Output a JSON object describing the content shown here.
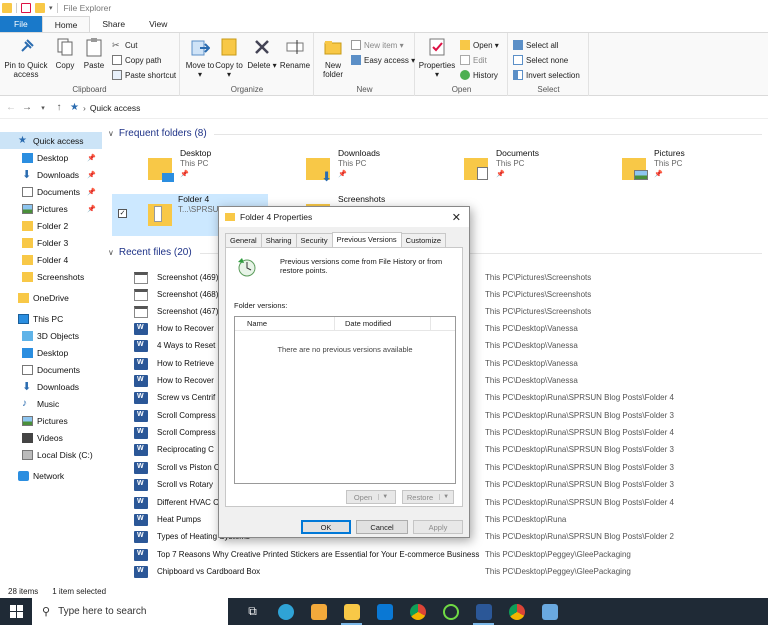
{
  "window": {
    "title": "File Explorer"
  },
  "ribbon": {
    "tabs": [
      "File",
      "Home",
      "Share",
      "View"
    ],
    "clipboard": {
      "label": "Clipboard",
      "pin": "Pin to Quick access",
      "copy": "Copy",
      "paste": "Paste",
      "cut": "Cut",
      "copy_path": "Copy path",
      "paste_shortcut": "Paste shortcut"
    },
    "organize": {
      "label": "Organize",
      "move_to": "Move to",
      "copy_to": "Copy to",
      "delete": "Delete",
      "rename": "Rename"
    },
    "new": {
      "label": "New",
      "new_folder": "New folder",
      "new_item": "New item",
      "easy_access": "Easy access"
    },
    "open": {
      "label": "Open",
      "properties": "Properties",
      "open": "Open",
      "edit": "Edit",
      "history": "History"
    },
    "select": {
      "label": "Select",
      "select_all": "Select all",
      "select_none": "Select none",
      "invert": "Invert selection"
    }
  },
  "address": {
    "location": "Quick access"
  },
  "nav": [
    {
      "label": "Quick access",
      "icon": "star-icon",
      "selected": true
    },
    {
      "label": "Desktop",
      "icon": "desktop-icon",
      "pinned": true
    },
    {
      "label": "Downloads",
      "icon": "download-icon",
      "pinned": true
    },
    {
      "label": "Documents",
      "icon": "documents-icon",
      "pinned": true
    },
    {
      "label": "Pictures",
      "icon": "pictures-icon",
      "pinned": true
    },
    {
      "label": "Folder 2",
      "icon": "folder-icon"
    },
    {
      "label": "Folder 3",
      "icon": "folder-icon"
    },
    {
      "label": "Folder 4",
      "icon": "folder-icon"
    },
    {
      "label": "Screenshots",
      "icon": "folder-icon"
    },
    {
      "label": "OneDrive",
      "icon": "folder-icon"
    },
    {
      "label": "This PC",
      "icon": "pc-icon"
    },
    {
      "label": "3D Objects",
      "icon": "cube-icon"
    },
    {
      "label": "Desktop",
      "icon": "desktop-icon"
    },
    {
      "label": "Documents",
      "icon": "documents-icon"
    },
    {
      "label": "Downloads",
      "icon": "download-icon"
    },
    {
      "label": "Music",
      "icon": "music-icon"
    },
    {
      "label": "Pictures",
      "icon": "pictures-icon"
    },
    {
      "label": "Videos",
      "icon": "video-icon"
    },
    {
      "label": "Local Disk (C:)",
      "icon": "disk-icon"
    },
    {
      "label": "Network",
      "icon": "network-icon"
    }
  ],
  "frequent": {
    "heading": "Frequent folders (8)",
    "items": [
      {
        "name": "Desktop",
        "sub": "This PC"
      },
      {
        "name": "Downloads",
        "sub": "This PC"
      },
      {
        "name": "Documents",
        "sub": "This PC"
      },
      {
        "name": "Pictures",
        "sub": "This PC"
      },
      {
        "name": "Folder 4",
        "sub": "T...\\SPRSUN"
      },
      {
        "name": "Screenshots",
        "sub": ""
      }
    ]
  },
  "recent": {
    "heading": "Recent files (20)",
    "items": [
      {
        "name": "Screenshot (469)",
        "location": "This PC\\Pictures\\Screenshots",
        "type": "screenshot"
      },
      {
        "name": "Screenshot (468)",
        "location": "This PC\\Pictures\\Screenshots",
        "type": "screenshot"
      },
      {
        "name": "Screenshot (467)",
        "location": "This PC\\Pictures\\Screenshots",
        "type": "screenshot"
      },
      {
        "name": "How to Recover",
        "location": "This PC\\Desktop\\Vanessa",
        "type": "word"
      },
      {
        "name": "4 Ways to Reset",
        "location": "This PC\\Desktop\\Vanessa",
        "type": "word"
      },
      {
        "name": "How to Retrieve",
        "location": "This PC\\Desktop\\Vanessa",
        "type": "word"
      },
      {
        "name": "How to Recover",
        "location": "This PC\\Desktop\\Vanessa",
        "type": "word"
      },
      {
        "name": "Screw vs Centrif",
        "location": "This PC\\Desktop\\Runa\\SPRSUN Blog Posts\\Folder 4",
        "type": "word"
      },
      {
        "name": "Scroll Compress",
        "location": "This PC\\Desktop\\Runa\\SPRSUN Blog Posts\\Folder 3",
        "type": "word"
      },
      {
        "name": "Scroll Compress",
        "location": "This PC\\Desktop\\Runa\\SPRSUN Blog Posts\\Folder 4",
        "type": "word"
      },
      {
        "name": "Reciprocating C",
        "location": "This PC\\Desktop\\Runa\\SPRSUN Blog Posts\\Folder 3",
        "type": "word"
      },
      {
        "name": "Scroll vs Piston C",
        "location": "This PC\\Desktop\\Runa\\SPRSUN Blog Posts\\Folder 3",
        "type": "word"
      },
      {
        "name": "Scroll vs Rotary",
        "location": "This PC\\Desktop\\Runa\\SPRSUN Blog Posts\\Folder 3",
        "type": "word"
      },
      {
        "name": "Different HVAC C",
        "location": "This PC\\Desktop\\Runa\\SPRSUN Blog Posts\\Folder 4",
        "type": "word"
      },
      {
        "name": "Heat Pumps",
        "location": "This PC\\Desktop\\Runa",
        "type": "word"
      },
      {
        "name": "Types of Heating Systems",
        "location": "This PC\\Desktop\\Runa\\SPRSUN Blog Posts\\Folder 2",
        "type": "word"
      },
      {
        "name": "Top 7 Reasons Why Creative Printed Stickers are Essential for Your E-commerce Business",
        "location": "This PC\\Desktop\\Peggey\\GleePackaging",
        "type": "word"
      },
      {
        "name": "Chipboard vs Cardboard Box",
        "location": "This PC\\Desktop\\Peggey\\GleePackaging",
        "type": "word"
      }
    ]
  },
  "status": {
    "items": "28 items",
    "selected": "1 item selected"
  },
  "taskbar": {
    "search_placeholder": "Type here to search"
  },
  "dialog": {
    "title": "Folder 4 Properties",
    "tabs": [
      "General",
      "Sharing",
      "Security",
      "Previous Versions",
      "Customize"
    ],
    "active_tab": "Previous Versions",
    "info": "Previous versions come from File History or from restore points.",
    "folder_versions_label": "Folder versions:",
    "col_name": "Name",
    "col_date": "Date modified",
    "empty": "There are no previous versions available",
    "open_btn": "Open",
    "restore_btn": "Restore",
    "ok": "OK",
    "cancel": "Cancel",
    "apply": "Apply"
  },
  "colors": {
    "accent": "#1979ca",
    "selection": "#cce8ff",
    "folder": "#f8c847",
    "section_heading": "#1e3287"
  }
}
